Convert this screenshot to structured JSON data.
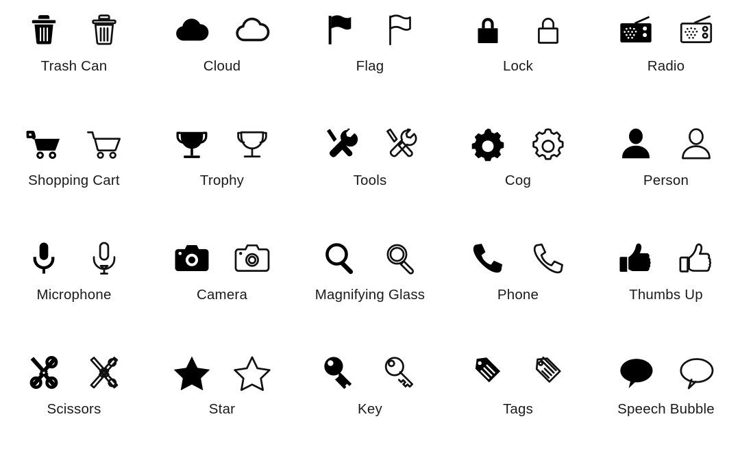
{
  "page": {
    "background_color": "#ffffff",
    "icon_color": "#000000",
    "label_color": "#1a1a1a",
    "columns": 5,
    "rows": 4,
    "variants": [
      "solid",
      "outline"
    ]
  },
  "icons": [
    {
      "name": "trash-can",
      "label": "Trash Can"
    },
    {
      "name": "cloud",
      "label": "Cloud"
    },
    {
      "name": "flag",
      "label": "Flag"
    },
    {
      "name": "lock",
      "label": "Lock"
    },
    {
      "name": "radio",
      "label": "Radio"
    },
    {
      "name": "shopping-cart",
      "label": "Shopping Cart"
    },
    {
      "name": "trophy",
      "label": "Trophy"
    },
    {
      "name": "tools",
      "label": "Tools"
    },
    {
      "name": "cog",
      "label": "Cog"
    },
    {
      "name": "person",
      "label": "Person"
    },
    {
      "name": "microphone",
      "label": "Microphone"
    },
    {
      "name": "camera",
      "label": "Camera"
    },
    {
      "name": "magnifying-glass",
      "label": "Magnifying Glass"
    },
    {
      "name": "phone",
      "label": "Phone"
    },
    {
      "name": "thumbs-up",
      "label": "Thumbs Up"
    },
    {
      "name": "scissors",
      "label": "Scissors"
    },
    {
      "name": "star",
      "label": "Star"
    },
    {
      "name": "key",
      "label": "Key"
    },
    {
      "name": "tags",
      "label": "Tags"
    },
    {
      "name": "speech-bubble",
      "label": "Speech Bubble"
    }
  ]
}
